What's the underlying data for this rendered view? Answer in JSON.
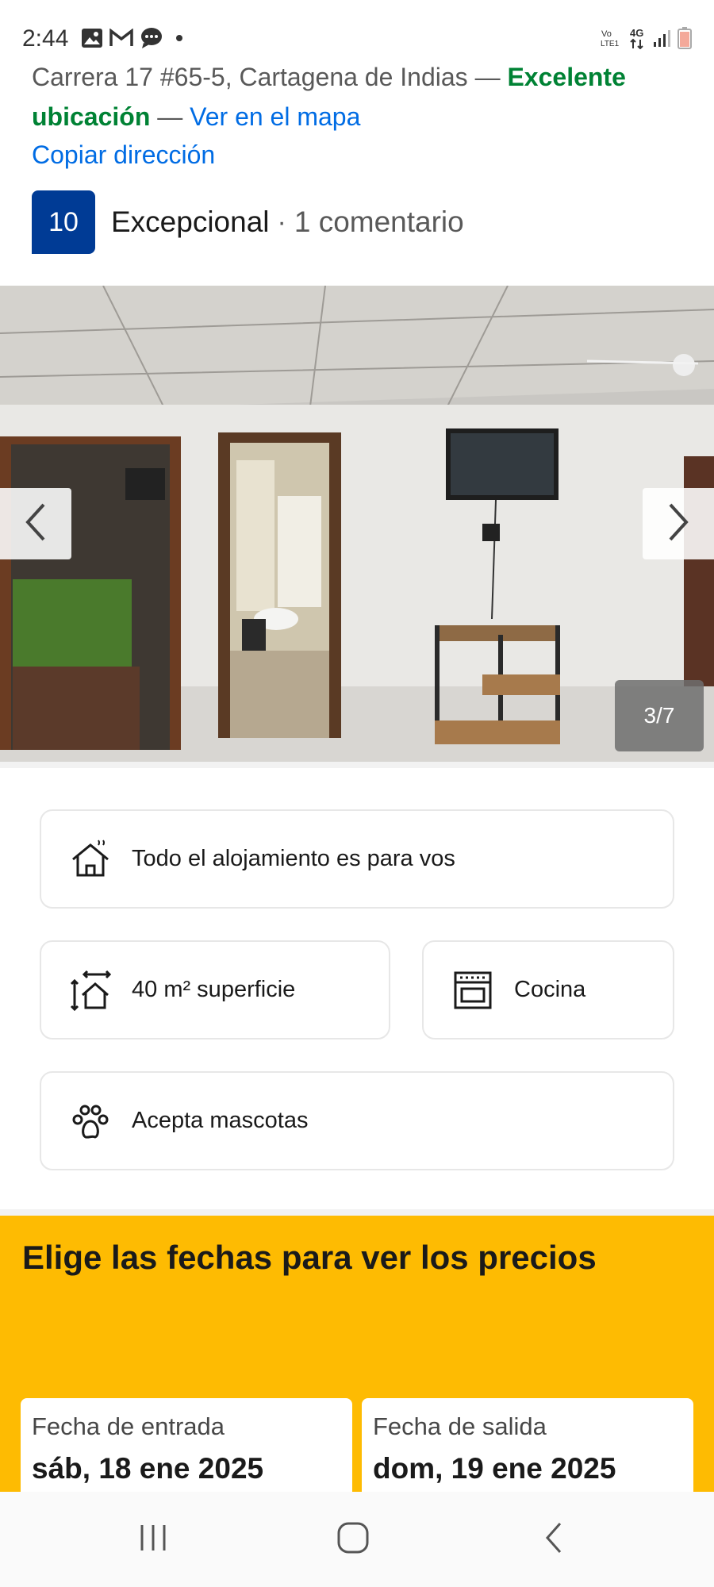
{
  "status_bar": {
    "time": "2:44",
    "left_icons": [
      "image-icon",
      "gmail-icon",
      "chat-icon",
      "dot-icon"
    ],
    "right_icons": [
      "volte-icon",
      "4g-icon",
      "signal-icon",
      "battery-icon"
    ],
    "volte_label": "Vo\nLTE1",
    "network_label": "4G"
  },
  "location": {
    "address": "Carrera 17 #65-5, Cartagena de Indias",
    "dash": "—",
    "highlight": "Excelente ubicación",
    "map_link": "Ver en el mapa",
    "copy_link": "Copiar dirección"
  },
  "rating": {
    "score": "10",
    "label": "Excepcional",
    "separator": "·",
    "reviews": "1 comentario"
  },
  "gallery": {
    "counter": "3/7",
    "current": 3,
    "total": 7
  },
  "features": [
    {
      "icon": "house-icon",
      "label": "Todo el alojamiento es para vos"
    },
    {
      "icon": "area-icon",
      "label": "40 m² superficie"
    },
    {
      "icon": "oven-icon",
      "label": "Cocina"
    },
    {
      "icon": "paw-icon",
      "label": "Acepta mascotas"
    }
  ],
  "dates": {
    "title": "Elige las fechas para ver los precios",
    "checkin_label": "Fecha de entrada",
    "checkin_value": "sáb, 18 ene 2025",
    "checkout_label": "Fecha de salida",
    "checkout_value": "dom, 19 ene 2025"
  },
  "colors": {
    "brand_blue": "#003b95",
    "link_blue": "#006ce4",
    "green": "#008234",
    "yellow": "#febb02"
  }
}
